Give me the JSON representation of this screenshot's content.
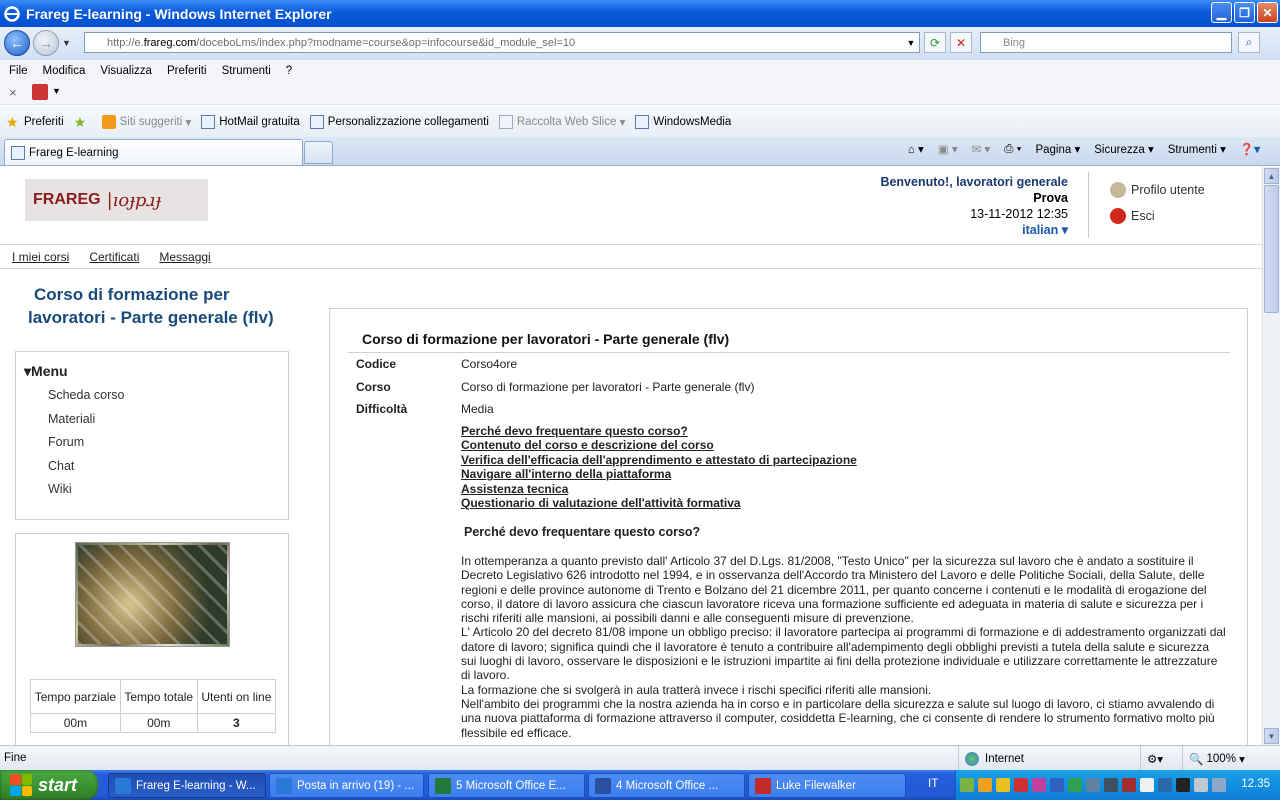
{
  "window": {
    "title": "Frareg E-learning - Windows Internet Explorer"
  },
  "address": {
    "url_prefix": "http://e.",
    "url_domain": "frareg.com",
    "url_rest": "/doceboLms/index.php?modname=course&op=infocourse&id_module_sel=10",
    "search_placeholder": "Bing"
  },
  "menubar": [
    "File",
    "Modifica",
    "Visualizza",
    "Preferiti",
    "Strumenti",
    "?"
  ],
  "favorites": {
    "label": "Preferiti",
    "items": [
      "Siti suggeriti",
      "HotMail gratuita",
      "Personalizzazione collegamenti",
      "Raccolta Web Slice",
      "WindowsMedia"
    ]
  },
  "tab": {
    "label": "Frareg E-learning"
  },
  "tools": [
    "Pagina",
    "Sicurezza",
    "Strumenti"
  ],
  "header": {
    "logo_text": "FRAREG",
    "logo_script": "|ıoɟpɹɟ",
    "welcome": "Benvenuto!, lavoratori generale",
    "user": "Prova",
    "datetime": "13-11-2012 12:35",
    "language": "italian",
    "profile": "Profilo utente",
    "logout": "Esci"
  },
  "topnav": [
    "I miei corsi",
    "Certificati",
    "Messaggi"
  ],
  "course_title": "Corso di formazione per lavoratori - Parte generale (flv)",
  "menu": {
    "title": "Menu",
    "items": [
      "Scheda corso",
      "Materiali",
      "Forum",
      "Chat",
      "Wiki"
    ]
  },
  "stats": {
    "headers": [
      "Tempo parziale",
      "Tempo totale",
      "Utenti on line"
    ],
    "values": [
      "00m",
      "00m",
      "3"
    ]
  },
  "content": {
    "title": "Corso di formazione per lavoratori - Parte generale (flv)",
    "fields": [
      {
        "key": "Codice",
        "value": "Corso4ore"
      },
      {
        "key": "Corso",
        "value": "Corso di formazione per lavoratori - Parte generale (flv)"
      },
      {
        "key": "Difficoltà",
        "value": "Media"
      }
    ],
    "links": [
      "Perché devo frequentare questo corso?",
      "Contenuto del corso e descrizione del corso",
      "Verifica dell'efficacia dell'apprendimento e attestato di partecipazione",
      "Navigare all'interno della piattaforma",
      "Assistenza tecnica",
      "Questionario di valutazione dell'attività formativa"
    ],
    "section_heading": "Perché devo frequentare questo corso?",
    "body": [
      "In ottemperanza a quanto previsto dall' Articolo 37 del D.Lgs. 81/2008, \"Testo Unico\" per la sicurezza sul lavoro che è andato a sostituire il Decreto Legislativo 626 introdotto nel 1994, e in osservanza dell'Accordo tra Ministero del Lavoro e delle Politiche Sociali, della Salute, delle regioni e delle province autonome di Trento e Bolzano del 21 dicembre 2011, per quanto concerne i contenuti e le modalità di erogazione del corso, il datore di lavoro assicura che ciascun lavoratore riceva una formazione sufficiente ed adeguata in materia di salute e sicurezza per i rischi riferiti alle mansioni, ai possibili danni e alle conseguenti misure di prevenzione.",
      "L' Articolo 20 del decreto 81/08 impone un obbligo preciso: il lavoratore partecipa ai programmi di formazione e di addestramento organizzati dal datore di lavoro; significa quindi che il lavoratore è tenuto a contribuire all'adempimento degli obblighi previsti a tutela della salute e sicurezza sui luoghi di lavoro, osservare le disposizioni e le istruzioni impartite ai fini della protezione individuale e utilizzare correttamente le attrezzature di lavoro.",
      "La formazione che si svolgerà in aula tratterà invece i rischi specifici riferiti alle mansioni.",
      "Nell'ambito dei programmi che la nostra azienda ha in corso e in particolare della sicurezza e salute sul luogo di lavoro, ci stiamo avvalendo di una nuova piattaforma di formazione attraverso il computer, cosiddetta E-learning, che ci consente di rendere lo strumento formativo molto più flessibile ed efficace."
    ]
  },
  "statusbar": {
    "text": "Fine",
    "zone": "Internet",
    "zoom": "100%"
  },
  "taskbar": {
    "start": "start",
    "tasks": [
      "Frareg E-learning - W...",
      "Posta in arrivo (19) - ...",
      "5 Microsoft Office E...",
      "4 Microsoft Office ...",
      "Luke Filewalker"
    ],
    "lang": "IT",
    "clock": "12.35"
  }
}
